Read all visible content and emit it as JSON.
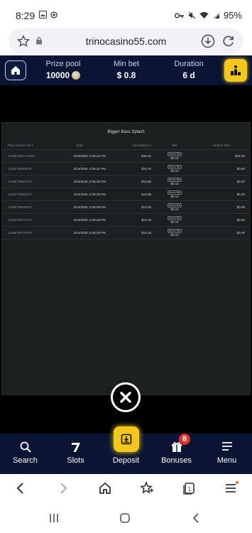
{
  "status_bar": {
    "time": "8:29",
    "battery": "95%"
  },
  "browser": {
    "url": "trinocasino55.com"
  },
  "tournament": {
    "prize_pool_label": "Prize pool",
    "prize_pool_value": "10000",
    "min_bet_label": "Min bet",
    "min_bet_value": "$ 0.8",
    "duration_label": "Duration",
    "duration_value": "6 d"
  },
  "history": {
    "title": "Bigger Bass Splash",
    "columns": {
      "id": "Play Session ID #",
      "date": "Date",
      "balance": "New Balance",
      "bet": "Bet",
      "win": "Amount Won"
    },
    "bonus_label": "Bonus Bet",
    "rows": [
      {
        "id": "11496798O124027",
        "date": "3/13/2026, 8:28:32 PM",
        "balance": "$35.45",
        "bet": "$0.10",
        "win": "$21.80"
      },
      {
        "id": "11496798908027",
        "date": "3/13/2026, 8:28:31 PM",
        "balance": "$13.75",
        "bet": "$0.10",
        "win": "$0.00"
      },
      {
        "id": "11496798820027",
        "date": "3/13/2026, 8:28:30 PM",
        "balance": "$13.85",
        "bet": "$0.10",
        "win": "$0.00"
      },
      {
        "id": "11496798692027",
        "date": "3/13/2026, 8:28:29 PM",
        "balance": "$13.95",
        "bet": "$0.10",
        "win": "$0.00"
      },
      {
        "id": "11496798630027",
        "date": "3/13/2026, 8:28:28 PM",
        "balance": "$14.05",
        "bet": "$0.10",
        "win": "$0.00"
      },
      {
        "id": "11496798471027",
        "date": "3/13/2026, 8:28:26 PM",
        "balance": "$14.15",
        "bet": "$0.10",
        "win": "$0.00"
      },
      {
        "id": "11496798370027",
        "date": "3/13/2026, 8:28:25 PM",
        "balance": "$14.25",
        "bet": "$0.10",
        "win": "$0.00"
      }
    ]
  },
  "casino_nav": {
    "search": "Search",
    "slots": "Slots",
    "deposit": "Deposit",
    "bonuses": "Bonuses",
    "bonuses_badge": "8",
    "menu": "Menu"
  },
  "colors": {
    "navy": "#0a1533",
    "gold": "#f4c81a",
    "badge_red": "#e0312f"
  }
}
